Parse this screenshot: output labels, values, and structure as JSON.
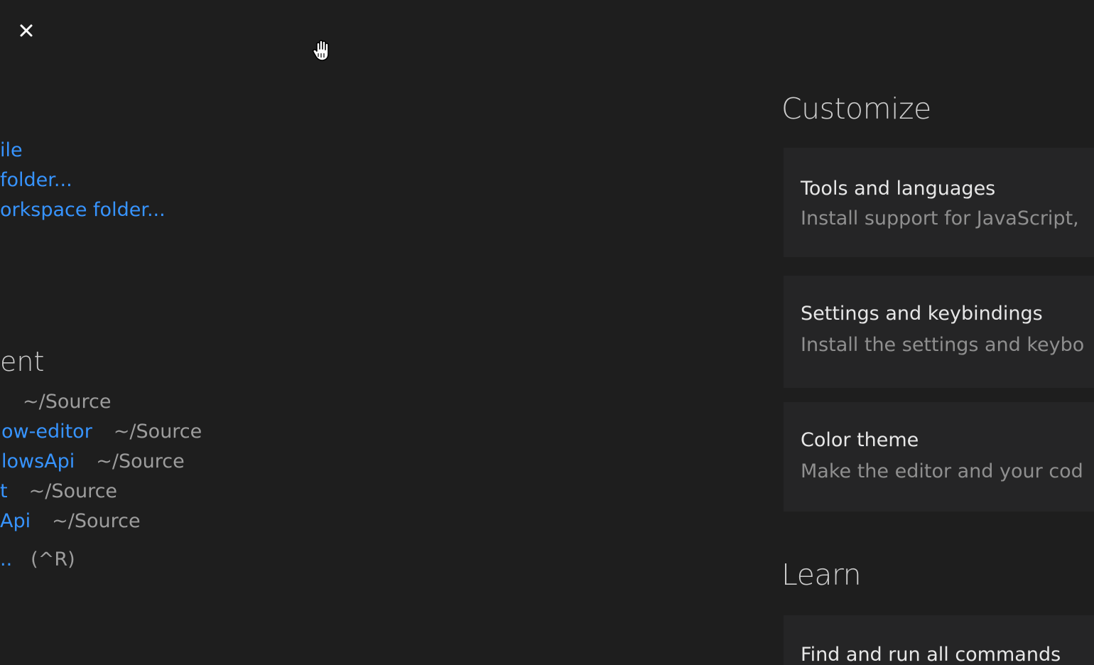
{
  "window": {
    "close_icon": "close-icon",
    "cursor_icon": "grab-hand-icon"
  },
  "start": {
    "links": [
      "ile",
      "folder...",
      "orkspace folder..."
    ]
  },
  "recent": {
    "heading": "ent",
    "items": [
      {
        "name": "",
        "path": "~/Source"
      },
      {
        "name": "ow-editor",
        "path": "~/Source"
      },
      {
        "name": "lowsApi",
        "path": "~/Source"
      },
      {
        "name": "t",
        "path": "~/Source"
      },
      {
        "name": "Api",
        "path": "~/Source"
      }
    ],
    "more_label": "..",
    "more_shortcut": "(^R)"
  },
  "customize": {
    "heading": "Customize",
    "cards": [
      {
        "title": "Tools and languages",
        "description": "Install support for JavaScript,"
      },
      {
        "title": "Settings and keybindings",
        "description": "Install the settings and keybo"
      },
      {
        "title": "Color theme",
        "description": "Make the editor and your cod"
      }
    ]
  },
  "learn": {
    "heading": "Learn",
    "cards": [
      {
        "title": "Find and run all commands"
      }
    ]
  },
  "colors": {
    "background": "#1e1e1e",
    "card": "#252526",
    "link": "#3794ff",
    "muted": "#9d9d9d"
  }
}
